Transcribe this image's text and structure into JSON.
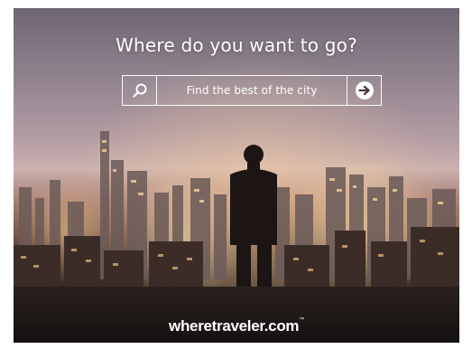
{
  "ad": {
    "headline": "Where do you want to go?",
    "search": {
      "placeholder": "Find the best of the city",
      "search_icon": "search-icon",
      "go_icon": "arrow-right-circle-icon"
    },
    "brand": {
      "name": "wheretraveler.com",
      "trademark": "™"
    },
    "colors": {
      "text": "#ffffff",
      "sky_top": "#6f6673",
      "city_glow": "#ffd6a0",
      "foreground": "#141111"
    }
  }
}
